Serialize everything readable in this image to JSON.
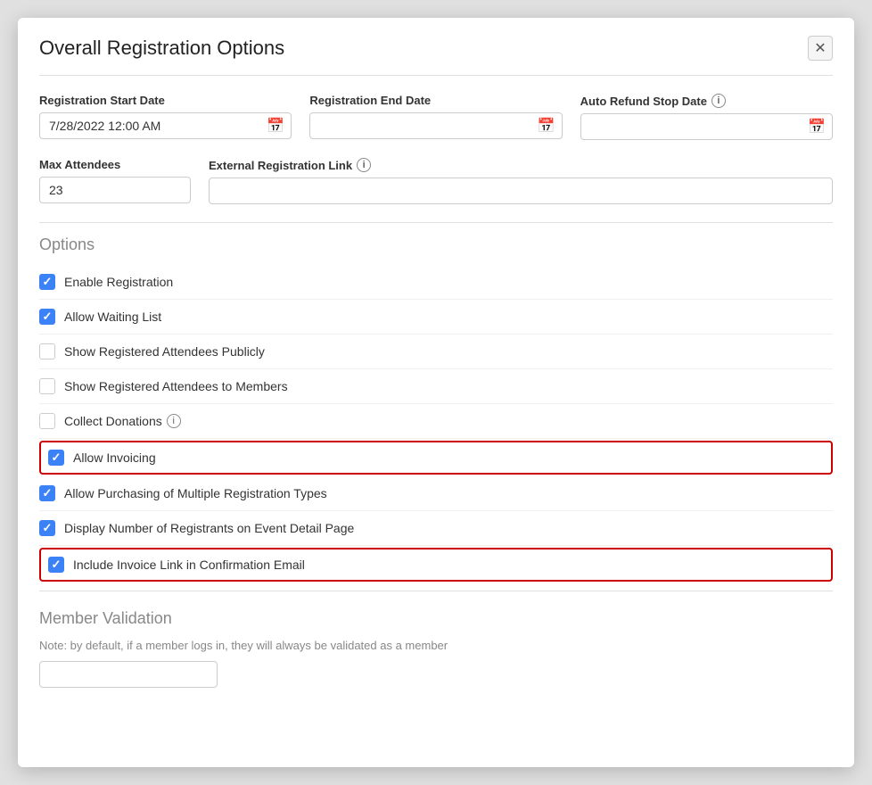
{
  "modal": {
    "title": "Overall Registration Options",
    "close_label": "✕"
  },
  "fields": {
    "reg_start_date_label": "Registration Start Date",
    "reg_start_date_value": "7/28/2022 12:00 AM",
    "reg_end_date_label": "Registration End Date",
    "reg_end_date_value": "",
    "auto_refund_label": "Auto Refund Stop Date",
    "auto_refund_value": "",
    "max_attendees_label": "Max Attendees",
    "max_attendees_value": "23",
    "external_link_label": "External Registration Link",
    "external_link_value": ""
  },
  "options": {
    "section_title": "Options",
    "items": [
      {
        "id": "enable_registration",
        "label": "Enable Registration",
        "checked": true,
        "highlighted": false,
        "info": false
      },
      {
        "id": "allow_waiting_list",
        "label": "Allow Waiting List",
        "checked": true,
        "highlighted": false,
        "info": false
      },
      {
        "id": "show_registered_publicly",
        "label": "Show Registered Attendees Publicly",
        "checked": false,
        "highlighted": false,
        "info": false
      },
      {
        "id": "show_registered_members",
        "label": "Show Registered Attendees to Members",
        "checked": false,
        "highlighted": false,
        "info": false
      },
      {
        "id": "collect_donations",
        "label": "Collect Donations",
        "checked": false,
        "highlighted": false,
        "info": true
      },
      {
        "id": "allow_invoicing",
        "label": "Allow Invoicing",
        "checked": true,
        "highlighted": true,
        "info": false
      },
      {
        "id": "allow_purchasing_multiple",
        "label": "Allow Purchasing of Multiple Registration Types",
        "checked": true,
        "highlighted": false,
        "info": false
      },
      {
        "id": "display_registrant_count",
        "label": "Display Number of Registrants on Event Detail Page",
        "checked": true,
        "highlighted": false,
        "info": false
      },
      {
        "id": "include_invoice_link",
        "label": "Include Invoice Link in Confirmation Email",
        "checked": true,
        "highlighted": true,
        "info": false
      }
    ]
  },
  "member_validation": {
    "section_title": "Member Validation",
    "note": "Note: by default, if a member logs in, they will always be validated as a member"
  }
}
